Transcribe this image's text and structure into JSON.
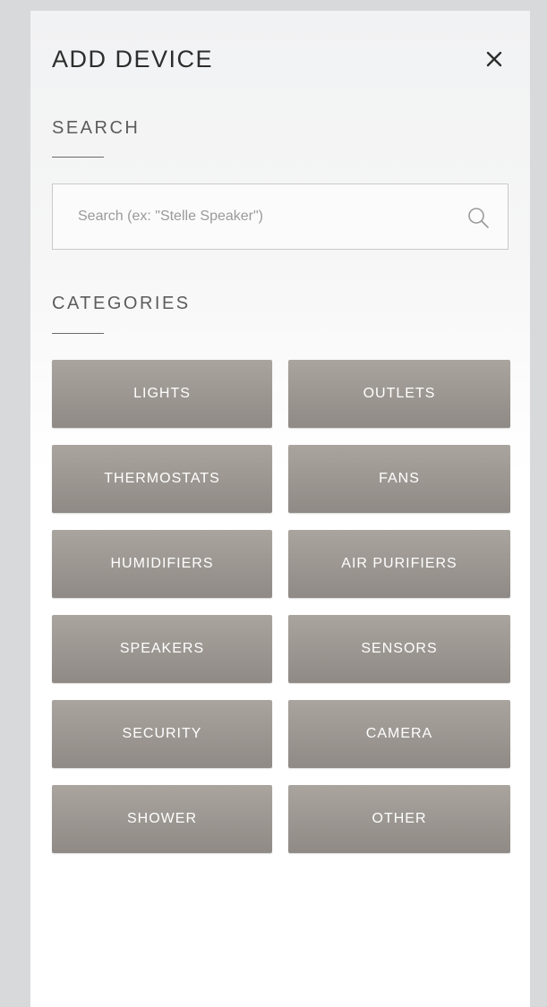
{
  "header": {
    "title": "ADD DEVICE",
    "close_icon": "close-icon"
  },
  "search": {
    "label": "SEARCH",
    "placeholder": "Search (ex: \"Stelle Speaker\")",
    "value": "",
    "icon": "search-icon"
  },
  "categories": {
    "label": "CATEGORIES",
    "items": [
      {
        "label": "LIGHTS"
      },
      {
        "label": "OUTLETS"
      },
      {
        "label": "THERMOSTATS"
      },
      {
        "label": "FANS"
      },
      {
        "label": "HUMIDIFIERS"
      },
      {
        "label": "AIR PURIFIERS"
      },
      {
        "label": "SPEAKERS"
      },
      {
        "label": "SENSORS"
      },
      {
        "label": "SECURITY"
      },
      {
        "label": "CAMERA"
      },
      {
        "label": "SHOWER"
      },
      {
        "label": "OTHER"
      }
    ]
  },
  "colors": {
    "page_background": "#d8d9db",
    "panel_background": "#f3f3f4",
    "button_fill": "#9c9691",
    "button_text": "#ffffff",
    "heading_text": "#2d2d2d"
  }
}
